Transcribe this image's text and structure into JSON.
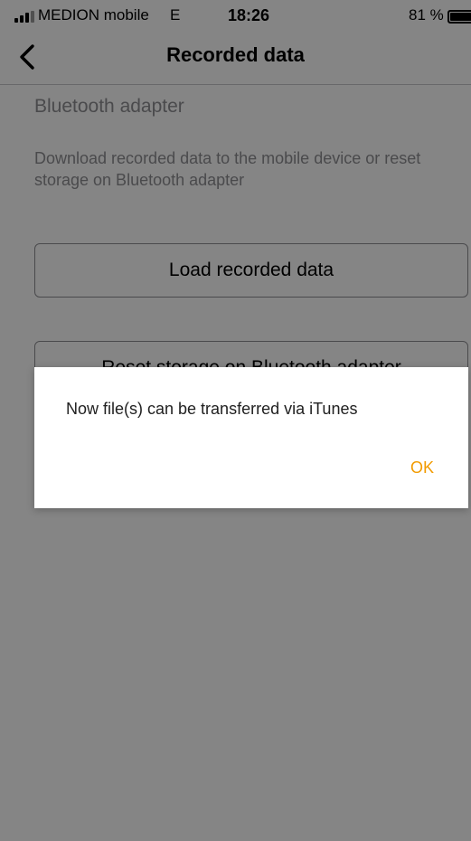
{
  "status_bar": {
    "carrier": "MEDION mobile",
    "network": "E",
    "time": "18:26",
    "battery": "81 %"
  },
  "nav": {
    "title": "Recorded data",
    "back_icon": "chevron-left-icon"
  },
  "content": {
    "section_title": "Bluetooth adapter",
    "description": "Download recorded data to the mobile device or reset storage on Bluetooth adapter",
    "load_button_label": "Load recorded data",
    "reset_button_label": "Reset storage on Bluetooth adapter"
  },
  "dialog": {
    "message": "Now file(s) can be transferred via iTunes",
    "ok_label": "OK"
  },
  "colors": {
    "accent": "#f29b00",
    "secondary_text": "#8e8e93",
    "overlay": "rgba(0,0,0,0.48)"
  }
}
